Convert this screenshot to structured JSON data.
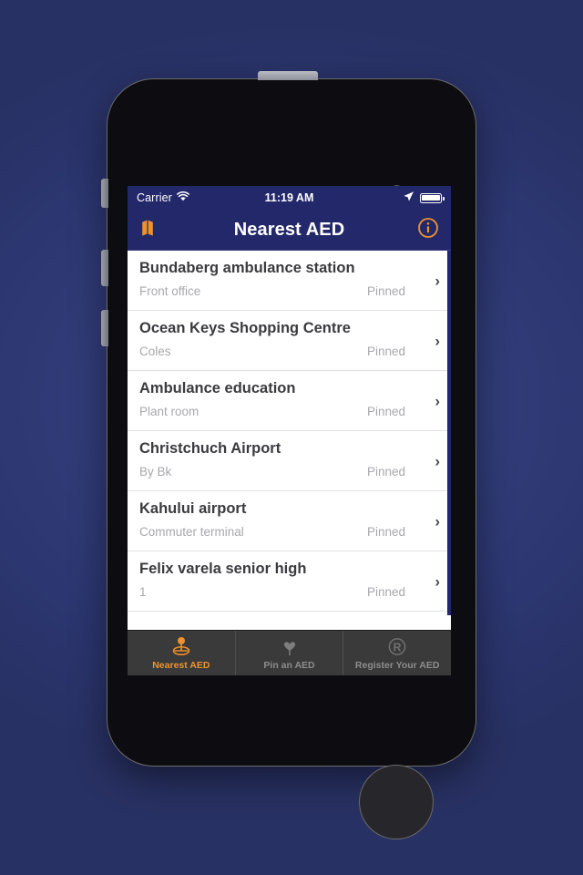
{
  "device": {
    "name": "iphone-mockup",
    "background_color": "#2e3873",
    "body_color": "#0d0d11"
  },
  "status_bar": {
    "carrier": "Carrier",
    "wifi_icon": "wifi-icon",
    "time": "11:19 AM",
    "location_icon": "location-arrow-icon",
    "battery_icon": "battery-full-icon",
    "background_color": "#22286a"
  },
  "nav_bar": {
    "left_icon": "map-icon",
    "title": "Nearest AED",
    "right_icon": "info-circle-icon",
    "accent_color": "#f0912d",
    "background_color": "#22286a"
  },
  "list": {
    "rows": [
      {
        "title": "Bundaberg ambulance station",
        "subtitle": "Front office",
        "status": "Pinned",
        "chevron": "›"
      },
      {
        "title": "Ocean Keys Shopping Centre",
        "subtitle": "Coles",
        "status": "Pinned",
        "chevron": "›"
      },
      {
        "title": "Ambulance education",
        "subtitle": "Plant room",
        "status": "Pinned",
        "chevron": "›"
      },
      {
        "title": "Christchuch Airport",
        "subtitle": "By Bk",
        "status": "Pinned",
        "chevron": "›"
      },
      {
        "title": "Kahului airport",
        "subtitle": "Commuter terminal",
        "status": "Pinned",
        "chevron": "›"
      },
      {
        "title": "Felix varela senior high",
        "subtitle": "1",
        "status": "Pinned",
        "chevron": "›"
      }
    ]
  },
  "tab_bar": {
    "background_color": "#3a3a3a",
    "active_color": "#f0912d",
    "inactive_color": "#8d8d8d",
    "tabs": [
      {
        "label": "Nearest AED",
        "icon": "map-pin-globe-icon",
        "active": true
      },
      {
        "label": "Pin an AED",
        "icon": "heart-pin-icon",
        "active": false
      },
      {
        "label": "Register Your AED",
        "icon": "registered-r-icon",
        "active": false
      }
    ]
  }
}
